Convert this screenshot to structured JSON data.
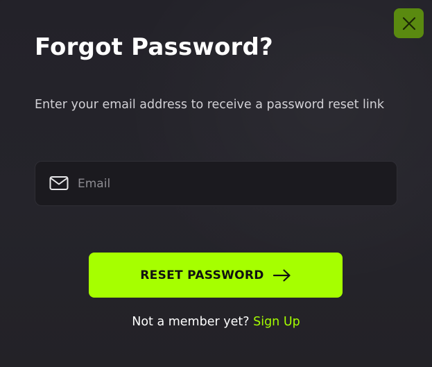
{
  "modal": {
    "title": "Forgot Password?",
    "subtitle": "Enter your email address to receive a password reset link",
    "close_icon": "close-icon"
  },
  "email": {
    "icon": "mail-icon",
    "value": "",
    "placeholder": "Email"
  },
  "reset_button": {
    "label": "RESET PASSWORD",
    "icon": "arrow-right-icon"
  },
  "footer": {
    "prompt": "Not a member yet?",
    "link_label": "Sign Up"
  },
  "colors": {
    "accent": "#a6ff00",
    "close_button": "#5a8a10",
    "background": "#232128",
    "input_background": "#1b1a1f"
  }
}
